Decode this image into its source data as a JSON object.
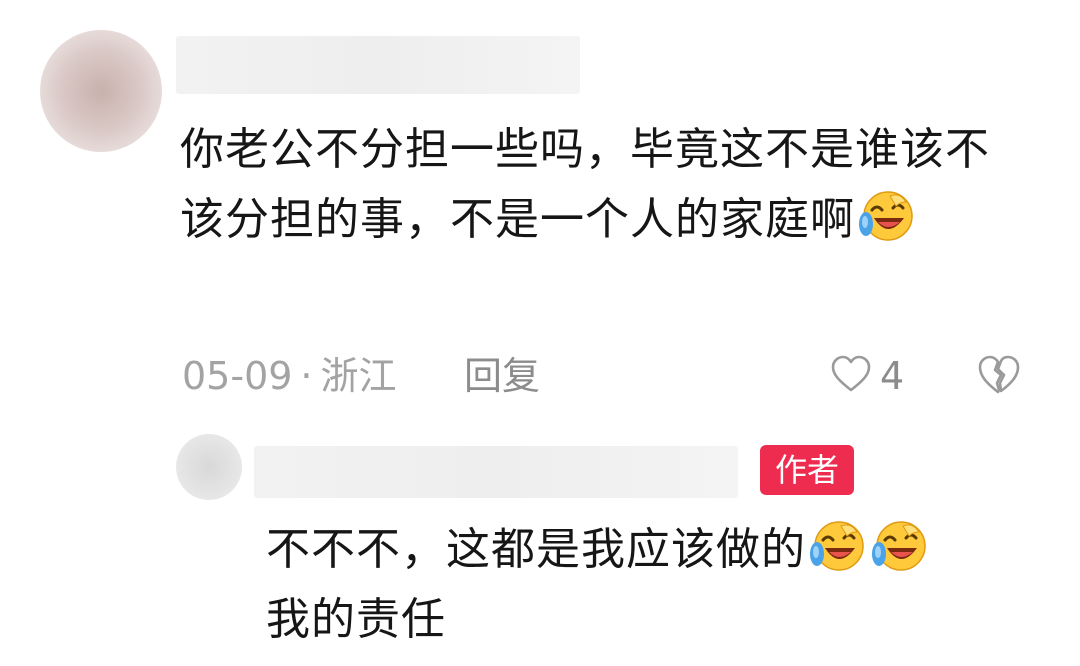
{
  "comment": {
    "text": "你老公不分担一些吗，毕竟这不是谁该不该分担的事，不是一个人的家庭啊",
    "emoji": "laugh-cry-emoji",
    "date": "05-09",
    "separator": "·",
    "location": "浙江",
    "reply_label": "回复",
    "like_count": "4"
  },
  "reply": {
    "badge": "作者",
    "text": "不不不，这都是我应该做的",
    "text_line2": "我的责任",
    "emojis": [
      "laugh-cry-emoji",
      "laugh-cry-emoji"
    ]
  },
  "colors": {
    "badge_bg": "#ee2c4f",
    "meta_gray": "#a3a3a3",
    "text": "#161616"
  }
}
